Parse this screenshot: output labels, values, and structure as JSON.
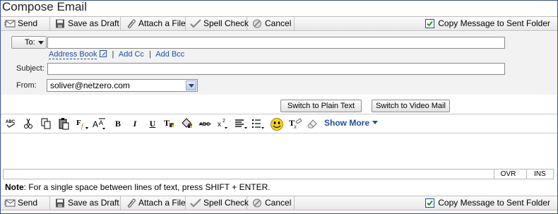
{
  "window": {
    "title": "Compose Email"
  },
  "toolbar": {
    "send": "Send",
    "save_draft": "Save as Draft",
    "attach": "Attach a File",
    "spell_check": "Spell Check",
    "cancel": "Cancel",
    "copy_to_sent": "Copy Message to Sent Folder",
    "copy_to_sent_checked": true
  },
  "compose": {
    "to_label": "To:",
    "to_value": "",
    "address_book": "Address Book",
    "add_cc": "Add Cc",
    "add_bcc": "Add Bcc",
    "separator": "|",
    "subject_label": "Subject:",
    "subject_value": "",
    "from_label": "From:",
    "from_value": "soliver@netzero.com"
  },
  "switch": {
    "plain_text": "Switch to Plain Text",
    "video_mail": "Switch to Video Mail"
  },
  "format_toolbar": {
    "show_more": "Show More",
    "icons": [
      "spell-abc-icon",
      "cut-icon",
      "copy-icon",
      "paste-icon",
      "font-family-icon",
      "font-size-icon",
      "bold-icon",
      "italic-icon",
      "underline-icon",
      "text-color-icon",
      "highlight-color-icon",
      "strikethrough-icon",
      "superscript-icon",
      "align-icon",
      "list-icon",
      "emoticon-icon",
      "remove-format-icon",
      "eraser-icon"
    ]
  },
  "status": {
    "ovr": "OVR",
    "ins": "INS"
  },
  "note": {
    "label": "Note",
    "text": ": For a single space between lines of text, press SHIFT + ENTER."
  },
  "colors": {
    "link": "#1f4fa3",
    "frame": "#3a4f8f",
    "checkbox_green": "#1a8a1a"
  }
}
